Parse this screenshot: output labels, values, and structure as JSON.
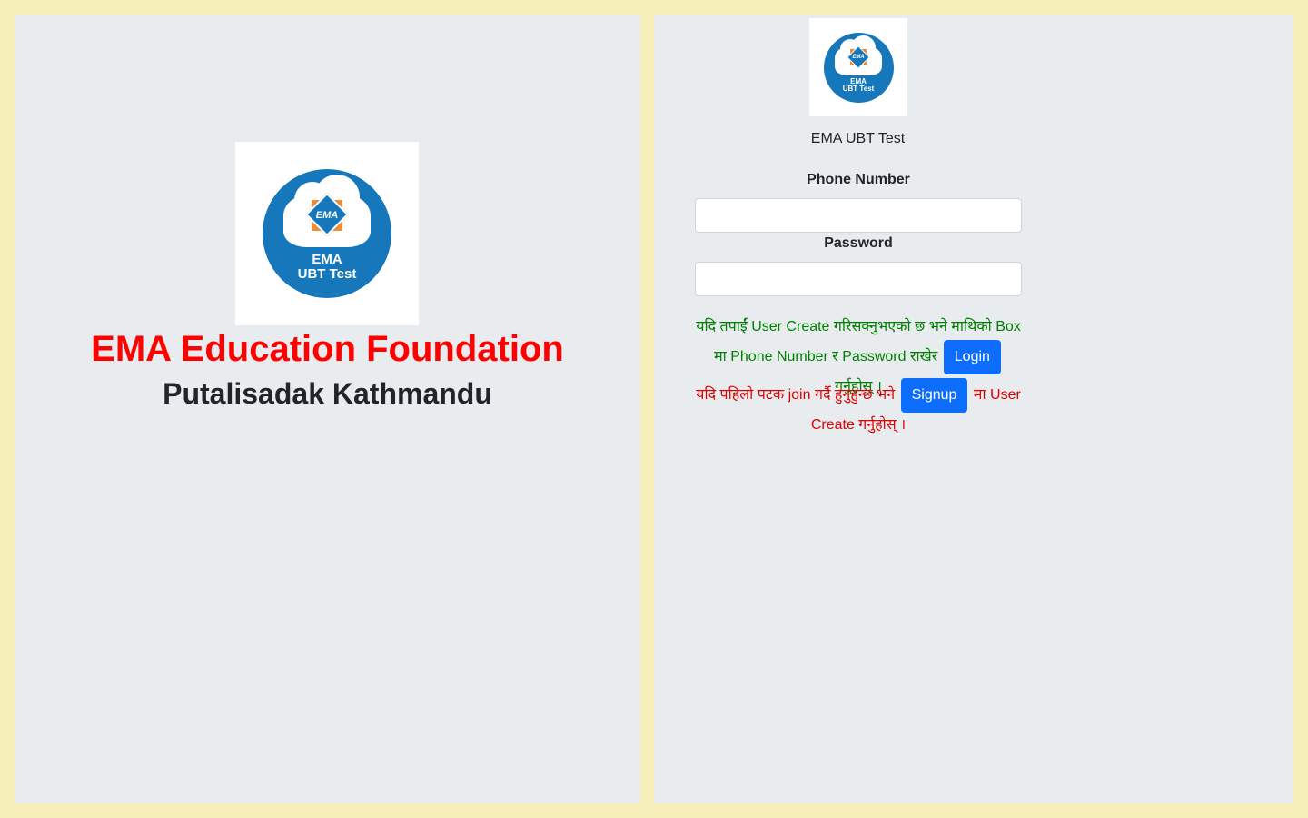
{
  "left": {
    "org_title": "EMA Education Foundation",
    "org_subtitle": "Putalisadak Kathmandu",
    "logo": {
      "emblem_text": "EMA",
      "line1": "EMA",
      "line2": "UBT Test"
    }
  },
  "right": {
    "logo": {
      "emblem_text": "EMA",
      "line1": "EMA",
      "line2": "UBT Test"
    },
    "app_name": "EMA UBT Test",
    "form": {
      "phone_label": "Phone Number",
      "phone_value": "",
      "password_label": "Password",
      "password_value": ""
    },
    "login_message": {
      "before": "यदि तपाईं User Create गरिसक्नुभएको छ भने माथिको Box मा Phone Number र Password राखेर",
      "button": "Login",
      "after": "गर्नुहोस् ।"
    },
    "signup_message": {
      "before": "यदि पहिलो पटक join गर्दै हुनुहुन्छ भने",
      "button": "Signup",
      "after": "मा User Create गर्नुहोस् ।"
    }
  },
  "colors": {
    "page_bg": "#f6efba",
    "panel_bg": "#e9ecef",
    "title_red": "#ff0000",
    "message_green": "#008000",
    "message_red": "#e00000",
    "button_blue": "#0d6efd",
    "logo_blue": "#1677bb",
    "logo_orange": "#ef8c37"
  },
  "icons": [
    "ema-ubt-logo-icon",
    "cloud-icon"
  ]
}
